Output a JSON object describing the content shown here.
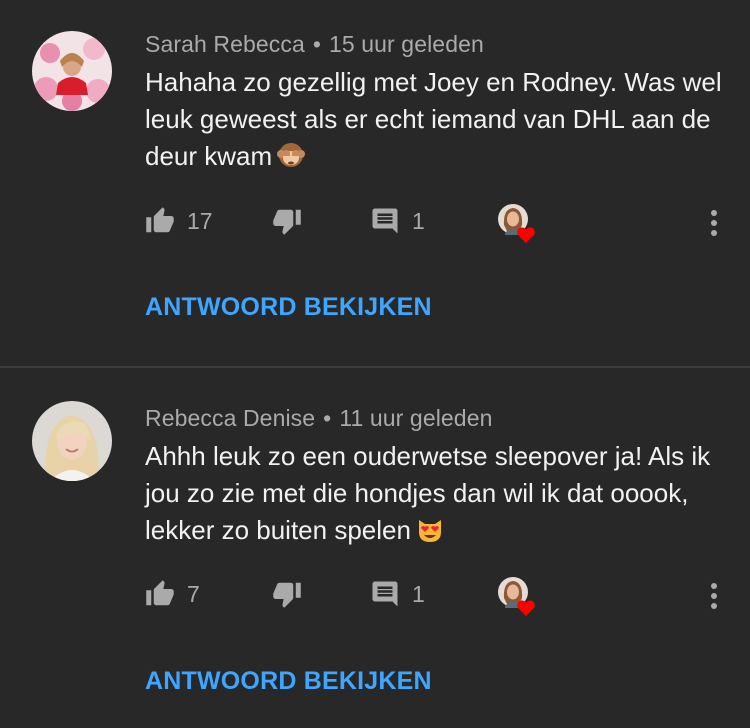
{
  "comments": [
    {
      "author": "Sarah Rebecca",
      "separator": "•",
      "timestamp": "15 uur geleden",
      "text": "Hahaha zo gezellig met Joey en Rodney. Was wel leuk geweest als er echt iemand van DHL aan de deur kwam",
      "emoji": "see-no-evil-monkey",
      "likes": "17",
      "replies": "1",
      "view_replies_label": "ANTWOORD BEKIJKEN"
    },
    {
      "author": "Rebecca Denise",
      "separator": "•",
      "timestamp": "11 uur geleden",
      "text": "Ahhh leuk zo een ouderwetse sleepover ja! Als ik jou zo zie met die hondjes dan wil ik dat ooook, lekker zo buiten spelen",
      "emoji": "smiling-cat-heart-eyes",
      "likes": "7",
      "replies": "1",
      "view_replies_label": "ANTWOORD BEKIJKEN"
    }
  ],
  "colors": {
    "background": "#282828",
    "meta_text": "#aaaaaa",
    "link": "#3ea6ff",
    "heart": "#ff0000"
  }
}
